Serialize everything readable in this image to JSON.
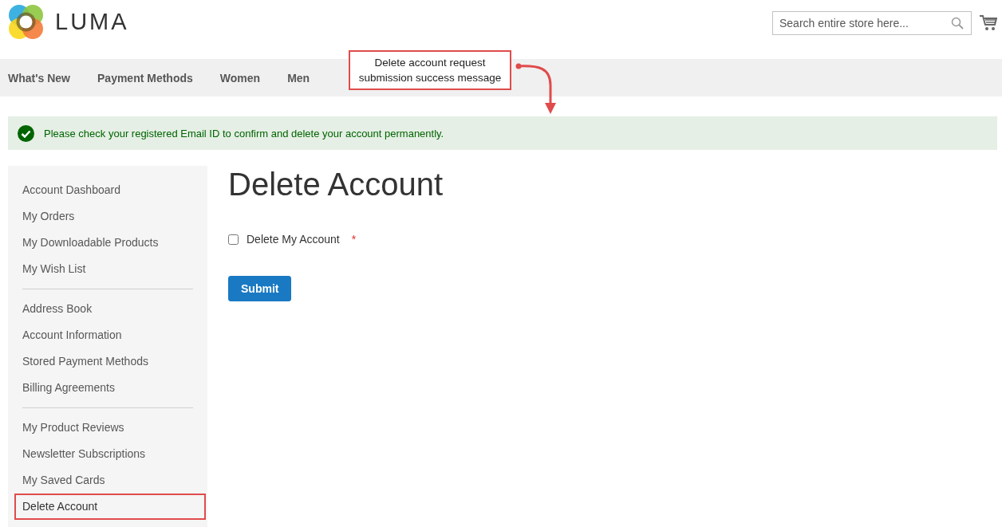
{
  "header": {
    "logo_text": "LUMA",
    "search": {
      "placeholder": "Search entire store here..."
    }
  },
  "nav": {
    "items": [
      "What's New",
      "Payment Methods",
      "Women",
      "Men"
    ]
  },
  "message": {
    "kind": "success",
    "text": "Please check your registered Email ID to confirm and delete your account permanently."
  },
  "sidebar": {
    "groups": [
      {
        "items": [
          {
            "label": "Account Dashboard",
            "selected": false
          },
          {
            "label": "My Orders",
            "selected": false
          },
          {
            "label": "My Downloadable Products",
            "selected": false
          },
          {
            "label": "My Wish List",
            "selected": false
          }
        ]
      },
      {
        "items": [
          {
            "label": "Address Book",
            "selected": false
          },
          {
            "label": "Account Information",
            "selected": false
          },
          {
            "label": "Stored Payment Methods",
            "selected": false
          },
          {
            "label": "Billing Agreements",
            "selected": false
          }
        ]
      },
      {
        "items": [
          {
            "label": "My Product Reviews",
            "selected": false
          },
          {
            "label": "Newsletter Subscriptions",
            "selected": false
          },
          {
            "label": "My Saved Cards",
            "selected": false
          },
          {
            "label": "Delete Account",
            "selected": true
          }
        ]
      }
    ]
  },
  "main": {
    "title": "Delete Account",
    "checkbox": {
      "label": "Delete My Account",
      "required_mark": "*",
      "checked": false
    },
    "submit": "Submit"
  },
  "annotation": {
    "text": "Delete account request submission success message"
  }
}
